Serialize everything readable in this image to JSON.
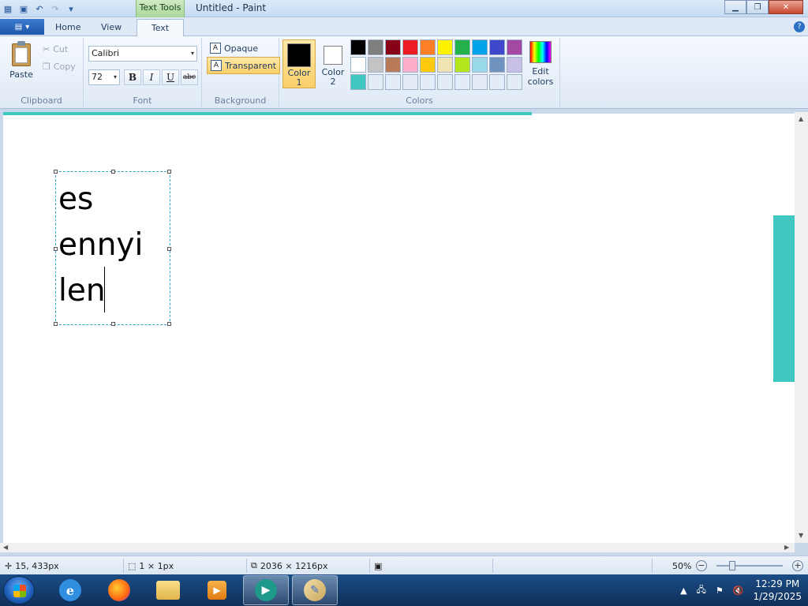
{
  "window": {
    "title": "Untitled - Paint",
    "context_tab": "Text Tools"
  },
  "tabs": [
    {
      "label": "Home"
    },
    {
      "label": "View"
    },
    {
      "label": "Text"
    }
  ],
  "clipboard": {
    "group_label": "Clipboard",
    "paste": "Paste",
    "cut": "Cut",
    "copy": "Copy"
  },
  "font": {
    "group_label": "Font",
    "family": "Calibri",
    "size": "72",
    "bold": "B",
    "italic": "I",
    "underline": "U",
    "strikethrough": "abc"
  },
  "background": {
    "group_label": "Background",
    "opaque": "Opaque",
    "transparent": "Transparent",
    "selected": "transparent"
  },
  "colors": {
    "group_label": "Colors",
    "color1_label": "Color\n1",
    "color2_label": "Color\n2",
    "color1": "#000000",
    "color2": "#ffffff",
    "edit_label": "Edit colors",
    "palette_row1": [
      "#000000",
      "#7f7f7f",
      "#880015",
      "#ed1c24",
      "#ff7f27",
      "#fff200",
      "#22b14c",
      "#00a2e8",
      "#3f48cc",
      "#a349a4"
    ],
    "palette_row2": [
      "#ffffff",
      "#c3c3c3",
      "#b97a57",
      "#ffaec9",
      "#ffc90e",
      "#efe4b0",
      "#b5e61d",
      "#99d9ea",
      "#7092be",
      "#c8bfe7"
    ],
    "palette_row3": [
      "#3ec8c1",
      "",
      "",
      "",
      "",
      "",
      "",
      "",
      "",
      ""
    ]
  },
  "canvas": {
    "text_lines": [
      "es",
      "ennyi",
      "len"
    ],
    "accent_color": "#3ec8c1"
  },
  "status": {
    "cursor": "15, 433px",
    "selection": "1 × 1px",
    "image_size": "2036 × 1216px",
    "zoom": "50%"
  },
  "taskbar": {
    "time": "12:29 PM",
    "date": "1/29/2025"
  }
}
